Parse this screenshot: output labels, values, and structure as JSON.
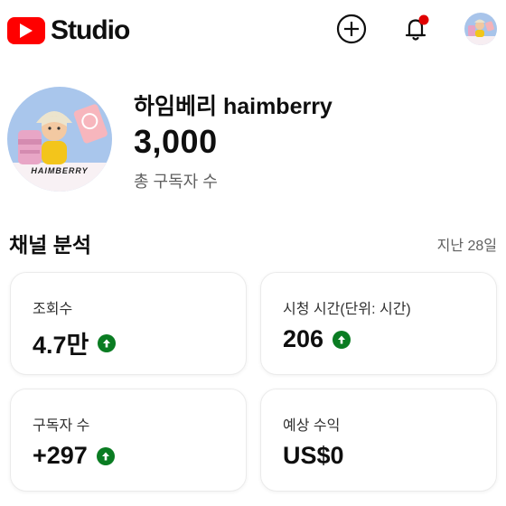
{
  "app": {
    "logo_text": "Studio"
  },
  "topbar": {
    "create_icon": "plus-circle-icon",
    "notifications_icon": "bell-icon",
    "notification_dot_color": "#e00000"
  },
  "channel": {
    "name": "하임베리 haimberry",
    "subscriber_count": "3,000",
    "subscriber_label": "총 구독자 수",
    "avatar_caption": "HAIMBERRY"
  },
  "analytics": {
    "title": "채널 분석",
    "period": "지난 28일",
    "cards": [
      {
        "label": "조회수",
        "value": "4.7만",
        "trend": "up"
      },
      {
        "label": "시청 시간(단위: 시간)",
        "value": "206",
        "trend": "up"
      },
      {
        "label": "구독자 수",
        "value": "+297",
        "trend": "up"
      },
      {
        "label": "예상 수익",
        "value": "US$0",
        "trend": "none"
      }
    ],
    "trend_color": "#0a7c22"
  },
  "colors": {
    "brand_red": "#ff0000"
  }
}
